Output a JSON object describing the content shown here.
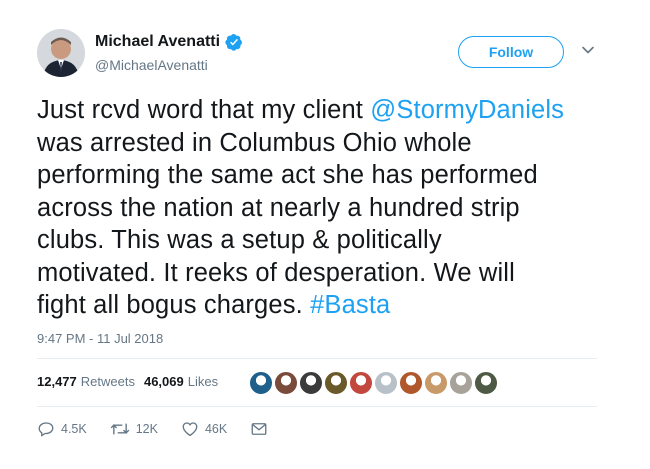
{
  "author": {
    "display_name": "Michael Avenatti",
    "handle": "@MichaelAvenatti",
    "verified": true
  },
  "header": {
    "follow_label": "Follow"
  },
  "tweet": {
    "text_lines": [
      [
        "Just rcvd word that my client ",
        {
          "link": "@StormyDaniels"
        }
      ],
      [
        "was arrested in Columbus Ohio whole"
      ],
      [
        "performing the same act she has performed"
      ],
      [
        "across the nation at nearly a hundred strip"
      ],
      [
        "clubs. This was a setup & politically"
      ],
      [
        "motivated. It reeks of desperation. We will"
      ],
      [
        "fight all bogus charges. ",
        {
          "link": "#Basta"
        }
      ]
    ],
    "timestamp": "9:47 PM - 11 Jul 2018"
  },
  "stats": {
    "retweets_count": "12,477",
    "retweets_label": "Retweets",
    "likes_count": "46,069",
    "likes_label": "Likes"
  },
  "likers": [
    {
      "color": "#1f5f8c",
      "name": "liker-avatar-1"
    },
    {
      "color": "#7a4a3a",
      "name": "liker-avatar-2"
    },
    {
      "color": "#3b3b3b",
      "name": "liker-avatar-3"
    },
    {
      "color": "#6a5a2a",
      "name": "liker-avatar-4"
    },
    {
      "color": "#c2473d",
      "name": "liker-avatar-5"
    },
    {
      "color": "#b8c0c8",
      "name": "liker-avatar-6"
    },
    {
      "color": "#b0572c",
      "name": "liker-avatar-7"
    },
    {
      "color": "#c89a6a",
      "name": "liker-avatar-8"
    },
    {
      "color": "#a8a39a",
      "name": "liker-avatar-9"
    },
    {
      "color": "#4e5a45",
      "name": "liker-avatar-10"
    }
  ],
  "actions": {
    "replies": "4.5K",
    "retweets": "12K",
    "likes": "46K"
  },
  "colors": {
    "link": "#1da1f2",
    "text": "#14171a",
    "secondary": "#657786",
    "divider": "#e6ecf0"
  }
}
